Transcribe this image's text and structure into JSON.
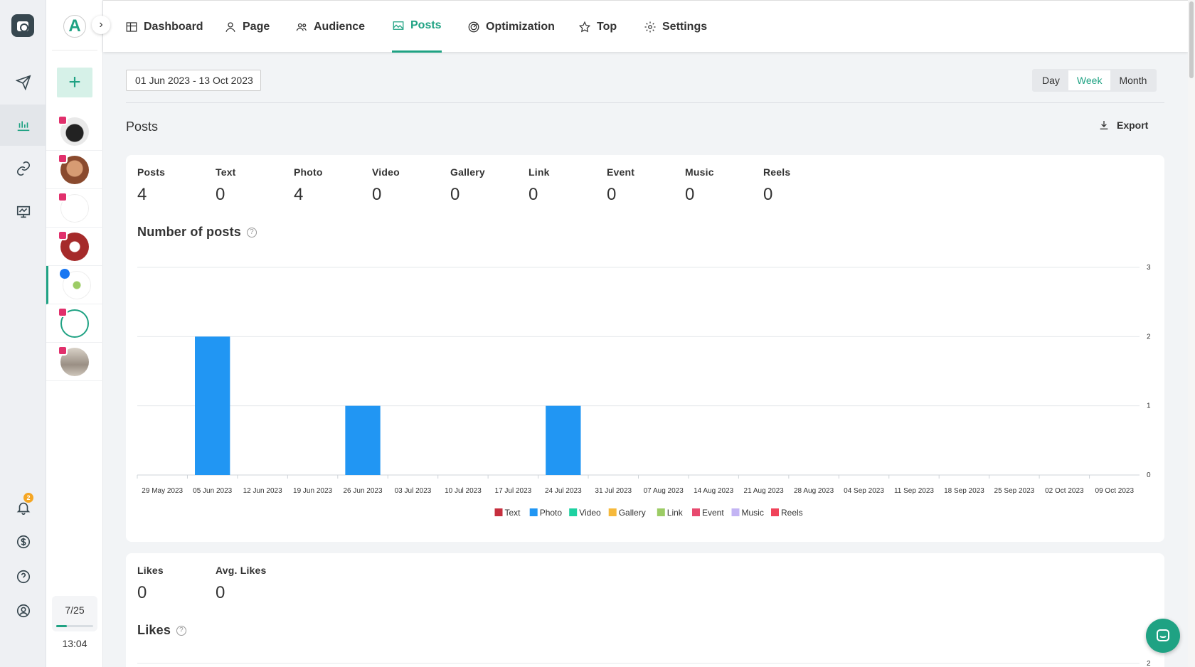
{
  "nav": {
    "tabs": [
      {
        "label": "Dashboard",
        "icon": "table-icon"
      },
      {
        "label": "Page",
        "icon": "user-icon"
      },
      {
        "label": "Audience",
        "icon": "users-icon"
      },
      {
        "label": "Posts",
        "icon": "image-icon",
        "active": true
      },
      {
        "label": "Optimization",
        "icon": "target-icon"
      },
      {
        "label": "Top",
        "icon": "star-icon"
      },
      {
        "label": "Settings",
        "icon": "gear-icon"
      }
    ]
  },
  "sidebar": {
    "workspace_letter": "A",
    "notification_count": "2",
    "accounts_counter": "7/25",
    "accounts_progress": 0.28,
    "time": "13:04"
  },
  "toolbar": {
    "date_range": "01 Jun 2023 - 13 Oct 2023",
    "period_options": [
      "Day",
      "Week",
      "Month"
    ],
    "period_selected": "Week"
  },
  "section": {
    "title": "Posts",
    "export_label": "Export"
  },
  "posts_stats": [
    {
      "label": "Posts",
      "value": "4"
    },
    {
      "label": "Text",
      "value": "0"
    },
    {
      "label": "Photo",
      "value": "4"
    },
    {
      "label": "Video",
      "value": "0"
    },
    {
      "label": "Gallery",
      "value": "0"
    },
    {
      "label": "Link",
      "value": "0"
    },
    {
      "label": "Event",
      "value": "0"
    },
    {
      "label": "Music",
      "value": "0"
    },
    {
      "label": "Reels",
      "value": "0"
    }
  ],
  "likes_stats": [
    {
      "label": "Likes",
      "value": "0"
    },
    {
      "label": "Avg. Likes",
      "value": "0"
    }
  ],
  "chart_titles": {
    "posts": "Number of posts",
    "likes": "Likes"
  },
  "colors": {
    "accent": "#1fa283",
    "photo": "#2196f3"
  },
  "chart_data": [
    {
      "type": "bar",
      "title": "Number of posts",
      "categories": [
        "29 May 2023",
        "05 Jun 2023",
        "12 Jun 2023",
        "19 Jun 2023",
        "26 Jun 2023",
        "03 Jul 2023",
        "10 Jul 2023",
        "17 Jul 2023",
        "24 Jul 2023",
        "31 Jul 2023",
        "07 Aug 2023",
        "14 Aug 2023",
        "21 Aug 2023",
        "28 Aug 2023",
        "04 Sep 2023",
        "11 Sep 2023",
        "18 Sep 2023",
        "25 Sep 2023",
        "02 Oct 2023",
        "09 Oct 2023"
      ],
      "series": [
        {
          "name": "Text",
          "color": "#c62f3e",
          "values": [
            0,
            0,
            0,
            0,
            0,
            0,
            0,
            0,
            0,
            0,
            0,
            0,
            0,
            0,
            0,
            0,
            0,
            0,
            0,
            0
          ]
        },
        {
          "name": "Photo",
          "color": "#2196f3",
          "values": [
            0,
            2,
            0,
            0,
            1,
            0,
            0,
            0,
            1,
            0,
            0,
            0,
            0,
            0,
            0,
            0,
            0,
            0,
            0,
            0
          ]
        },
        {
          "name": "Video",
          "color": "#1dd1a1",
          "values": [
            0,
            0,
            0,
            0,
            0,
            0,
            0,
            0,
            0,
            0,
            0,
            0,
            0,
            0,
            0,
            0,
            0,
            0,
            0,
            0
          ]
        },
        {
          "name": "Gallery",
          "color": "#f6b93b",
          "values": [
            0,
            0,
            0,
            0,
            0,
            0,
            0,
            0,
            0,
            0,
            0,
            0,
            0,
            0,
            0,
            0,
            0,
            0,
            0,
            0
          ]
        },
        {
          "name": "Link",
          "color": "#9ccc65",
          "values": [
            0,
            0,
            0,
            0,
            0,
            0,
            0,
            0,
            0,
            0,
            0,
            0,
            0,
            0,
            0,
            0,
            0,
            0,
            0,
            0
          ]
        },
        {
          "name": "Event",
          "color": "#e84a6f",
          "values": [
            0,
            0,
            0,
            0,
            0,
            0,
            0,
            0,
            0,
            0,
            0,
            0,
            0,
            0,
            0,
            0,
            0,
            0,
            0,
            0
          ]
        },
        {
          "name": "Music",
          "color": "#c3b4f4",
          "values": [
            0,
            0,
            0,
            0,
            0,
            0,
            0,
            0,
            0,
            0,
            0,
            0,
            0,
            0,
            0,
            0,
            0,
            0,
            0,
            0
          ]
        },
        {
          "name": "Reels",
          "color": "#f0435a",
          "values": [
            0,
            0,
            0,
            0,
            0,
            0,
            0,
            0,
            0,
            0,
            0,
            0,
            0,
            0,
            0,
            0,
            0,
            0,
            0,
            0
          ]
        }
      ],
      "yticks": [
        "0",
        "1",
        "2",
        "3"
      ],
      "ylim": [
        0,
        3
      ],
      "grid": true,
      "legend": "bottom-center"
    },
    {
      "type": "bar",
      "title": "Likes",
      "yticks": [
        "2"
      ]
    }
  ]
}
